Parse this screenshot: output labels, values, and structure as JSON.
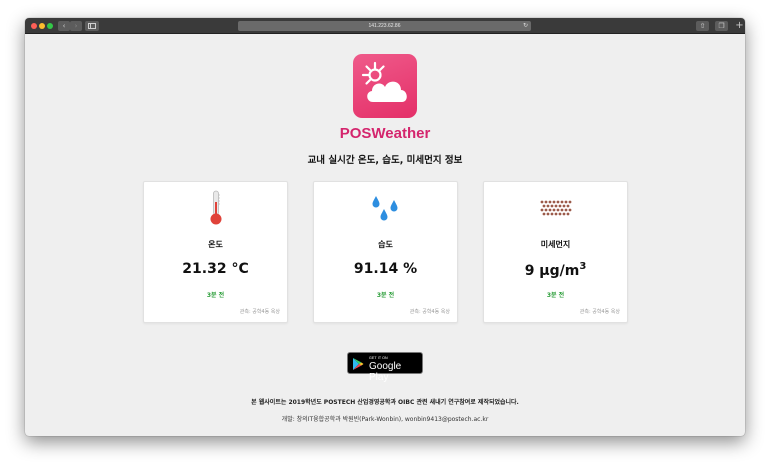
{
  "browser": {
    "url": "141.223.62.86",
    "icons": {
      "back": "chevron-left-icon",
      "forward": "chevron-right-icon",
      "sidebar": "sidebar-icon",
      "reload": "reload-icon",
      "share": "share-icon",
      "tabs": "tabs-overview-icon",
      "new_tab": "plus-icon"
    }
  },
  "app": {
    "name": "POSWeather",
    "subtitle": "교내 실시간 온도, 습도, 미세먼지 정보",
    "icon": "weather-sun-cloud-icon",
    "accent_color": "#d4256d"
  },
  "cards": [
    {
      "icon": "thermometer-icon",
      "label": "온도",
      "value": "21.32 °C",
      "age": "3분 전",
      "source": "관측: 공학4동 옥상"
    },
    {
      "icon": "water-drops-icon",
      "label": "습도",
      "value": "91.14 %",
      "age": "3분 전",
      "source": "관측: 공학4동 옥상"
    },
    {
      "icon": "dust-particles-icon",
      "label": "미세먼지",
      "value_main": "9 μg/m",
      "value_sup": "3",
      "age": "3분 전",
      "source": "관측: 공학4동 옥상"
    }
  ],
  "store_badge": {
    "small": "GET IT ON",
    "big": "Google Play",
    "icon": "google-play-icon"
  },
  "footer": {
    "line1": "본 웹사이트는 2019학년도 POSTECH 산업경영공학과 OIBC 관련 새내기 연구참여로 제작되었습니다.",
    "line2": "개발: 창의IT융합공학과 박원빈(Park-Wonbin), wonbin9413@postech.ac.kr"
  }
}
